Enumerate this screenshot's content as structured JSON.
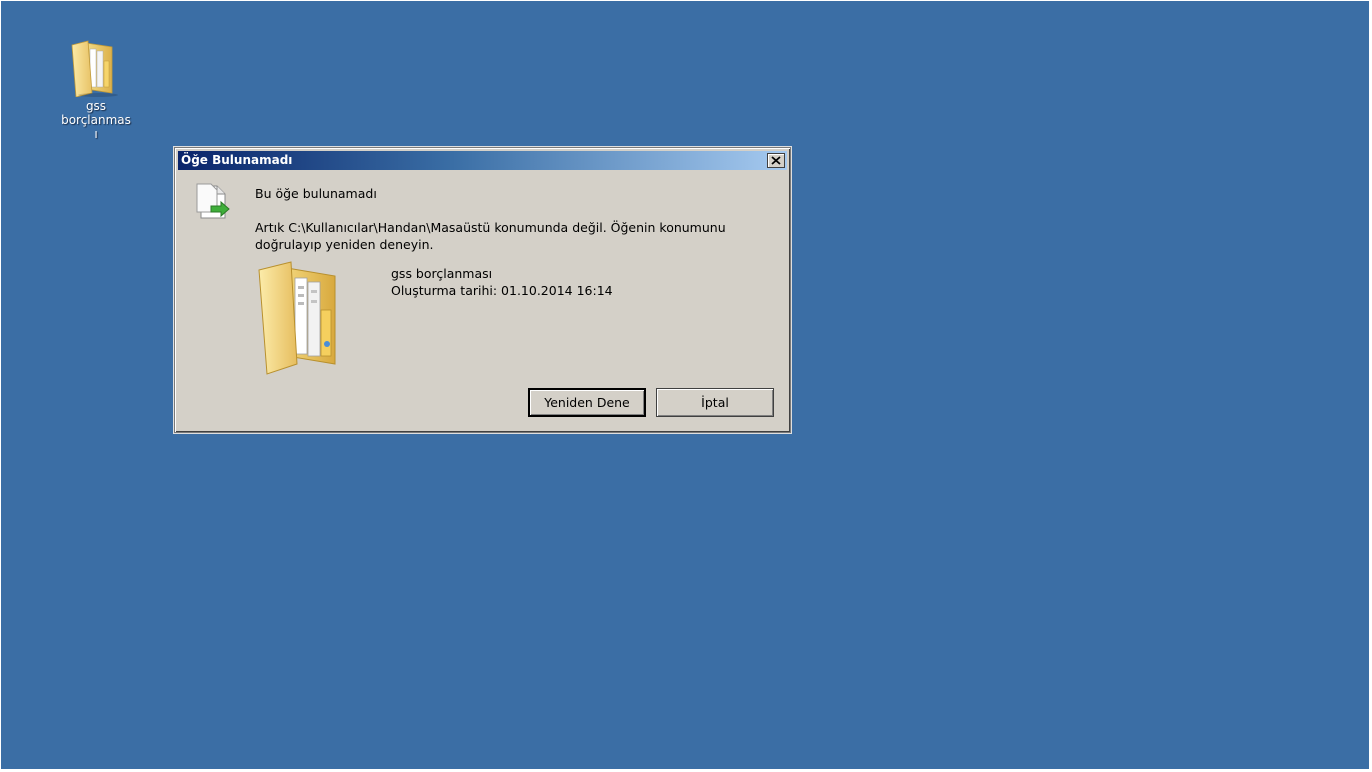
{
  "desktop": {
    "background_color": "#3b6ea5",
    "icon": {
      "icon_name": "folder-icon",
      "label": "gss borçlanması"
    }
  },
  "dialog": {
    "title": "Öğe Bulunamadı",
    "close_icon": "close-icon",
    "message_icon": "file-move-icon",
    "heading": "Bu öğe bulunamadı",
    "body": "Artık C:\\Kullanıcılar\\Handan\\Masaüstü konumunda değil. Öğenin konumunu doğrulayıp yeniden deneyin.",
    "item": {
      "icon_name": "folder-icon",
      "name": "gss borçlanması",
      "created": "Oluşturma tarihi: 01.10.2014 16:14"
    },
    "buttons": {
      "retry": "Yeniden Dene",
      "cancel": "İptal"
    }
  }
}
